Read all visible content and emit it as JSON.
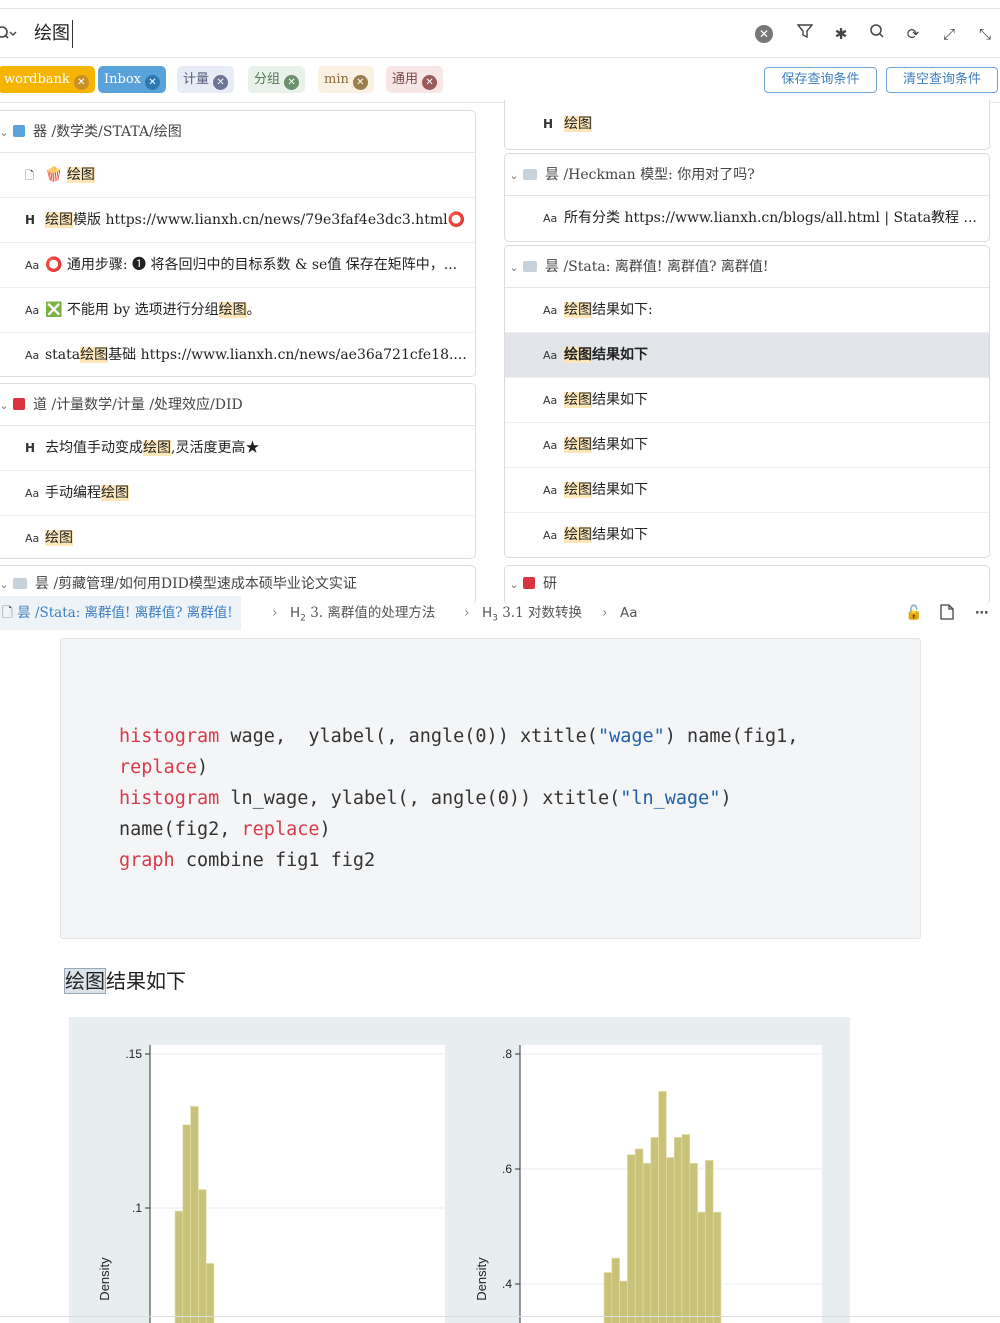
{
  "search": {
    "query": "绘图"
  },
  "toolbar": {
    "icons": [
      "filter-icon",
      "asterisk-icon",
      "search-loop-icon",
      "refresh-icon",
      "expand-icon",
      "collapse-icon"
    ]
  },
  "tags": [
    {
      "label": "wordbank",
      "bg": "#f4b400",
      "fg": "#ffffff",
      "x": "#c7912a"
    },
    {
      "label": "Inbox",
      "bg": "#5aa3da",
      "fg": "#ffffff",
      "x": "#2f77b3"
    },
    {
      "label": "计量",
      "bg": "#e8ecf6",
      "fg": "#555e7a",
      "x": "#6c7593"
    },
    {
      "label": "分组",
      "bg": "#e9f2ea",
      "fg": "#4e7a55",
      "x": "#6b8f6f"
    },
    {
      "label": "min",
      "bg": "#fbf1e2",
      "fg": "#8a6a3c",
      "x": "#9c7d4d"
    },
    {
      "label": "通用",
      "bg": "#f8e6e6",
      "fg": "#7a4a4a",
      "x": "#9a5a5a"
    }
  ],
  "query_buttons": {
    "save": "保存查询条件",
    "clear": "清空查询条件"
  },
  "left_panel": {
    "group1": {
      "header": "器 /数学类/STATA/绘图",
      "color": "#5aa3da",
      "rows": [
        {
          "kind": "doc",
          "pre": "",
          "hl": "绘图",
          "post": "",
          "icon": "🍿 "
        },
        {
          "kind": "H",
          "pre": "",
          "hl": "绘图",
          "post": "模版 https://www.lianxh.cn/news/79e3faf4e3dc3.html⭕"
        },
        {
          "kind": "Aa",
          "pre": "⭕ 通用步骤: ❶ 将各回归中的目标系数 & se值 保存在矩阵中，...",
          "hl": "",
          "post": ""
        },
        {
          "kind": "Aa",
          "pre": "❎ 不能用 by 选项进行分组",
          "hl": "绘图",
          "post": "。"
        },
        {
          "kind": "Aa",
          "pre": "stata",
          "hl": "绘图",
          "post": "基础 https://www.lianxh.cn/news/ae36a721cfe18...."
        }
      ]
    },
    "group2": {
      "header": "道 /计量数学/计量 /处理效应/DID",
      "color": "#d9333f",
      "rows": [
        {
          "kind": "H",
          "pre": "去均值手动变成",
          "hl": "绘图",
          "post": ",灵活度更高★"
        },
        {
          "kind": "Aa",
          "pre": "手动编程",
          "hl": "绘图",
          "post": ""
        },
        {
          "kind": "Aa",
          "pre": "",
          "hl": "绘图",
          "post": ""
        }
      ]
    },
    "group3": {
      "header": "昙 /剪藏管理/如何用DID模型速成本硕毕业论文实证"
    }
  },
  "right_panel": {
    "group0": {
      "rows": [
        {
          "kind": "H",
          "pre": "",
          "hl": "绘图",
          "post": ""
        }
      ]
    },
    "group1": {
      "header": "昙 /Heckman 模型: 你用对了吗?",
      "rows": [
        {
          "kind": "Aa",
          "pre": "所有分类 https://www.lianxh.cn/blogs/all.html | Stata教程 ...",
          "hl": "",
          "post": ""
        }
      ]
    },
    "group2": {
      "header": "昙 /Stata: 离群值! 离群值? 离群值!",
      "rows": [
        {
          "kind": "Aa",
          "pre": "",
          "hl": "绘图",
          "post": "结果如下:"
        },
        {
          "kind": "Aa",
          "pre": "",
          "hl": "绘图",
          "post": "结果如下",
          "selected": true
        },
        {
          "kind": "Aa",
          "pre": "",
          "hl": "绘图",
          "post": "结果如下"
        },
        {
          "kind": "Aa",
          "pre": "",
          "hl": "绘图",
          "post": "结果如下"
        },
        {
          "kind": "Aa",
          "pre": "",
          "hl": "绘图",
          "post": "结果如下"
        },
        {
          "kind": "Aa",
          "pre": "",
          "hl": "绘图",
          "post": "结果如下"
        }
      ]
    },
    "group3": {
      "header": "研",
      "color": "#d9333f"
    }
  },
  "breadcrumb": {
    "doc": "昙 /Stata: 离群值! 离群值? 离群值!",
    "h2": "3. 离群值的处理方法",
    "h3": "3.1 对数转换",
    "tail": "Aa"
  },
  "code": {
    "lines": [
      [
        {
          "t": "histogram",
          "c": "kw"
        },
        {
          "t": " wage,  ylabel(, angle(0)) xtitle(",
          "c": ""
        },
        {
          "t": "\"wage\"",
          "c": "st"
        },
        {
          "t": ") name(fig1,",
          "c": ""
        }
      ],
      [
        {
          "t": "replace",
          "c": "kw"
        },
        {
          "t": ")",
          "c": ""
        }
      ],
      [
        {
          "t": "histogram",
          "c": "kw"
        },
        {
          "t": " ln_wage, ylabel(, angle(0)) xtitle(",
          "c": ""
        },
        {
          "t": "\"ln_wage\"",
          "c": "st"
        },
        {
          "t": ")",
          "c": ""
        }
      ],
      [
        {
          "t": "name(fig2, ",
          "c": ""
        },
        {
          "t": "replace",
          "c": "kw"
        },
        {
          "t": ")",
          "c": ""
        }
      ],
      [
        {
          "t": "graph",
          "c": "kw"
        },
        {
          "t": " combine fig1 fig2",
          "c": ""
        }
      ]
    ]
  },
  "result_para": {
    "hl": "绘图",
    "rest": "结果如下"
  },
  "chart_data": [
    {
      "type": "bar",
      "ylabel": "Density",
      "yticks": [
        ".15",
        ".1"
      ],
      "ylim": [
        0.04,
        0.155
      ],
      "bar_color": "#c9c27a",
      "values": [
        0.099,
        0.127,
        0.133,
        0.106,
        0.082
      ]
    },
    {
      "type": "bar",
      "ylabel": "Density",
      "yticks": [
        ".8",
        ".6",
        ".4"
      ],
      "ylim": [
        0.345,
        0.805
      ],
      "bar_color": "#c9c27a",
      "values": [
        0.42,
        0.445,
        0.405,
        0.625,
        0.635,
        0.61,
        0.655,
        0.735,
        0.62,
        0.655,
        0.66,
        0.61,
        0.525,
        0.615,
        0.525
      ]
    }
  ]
}
